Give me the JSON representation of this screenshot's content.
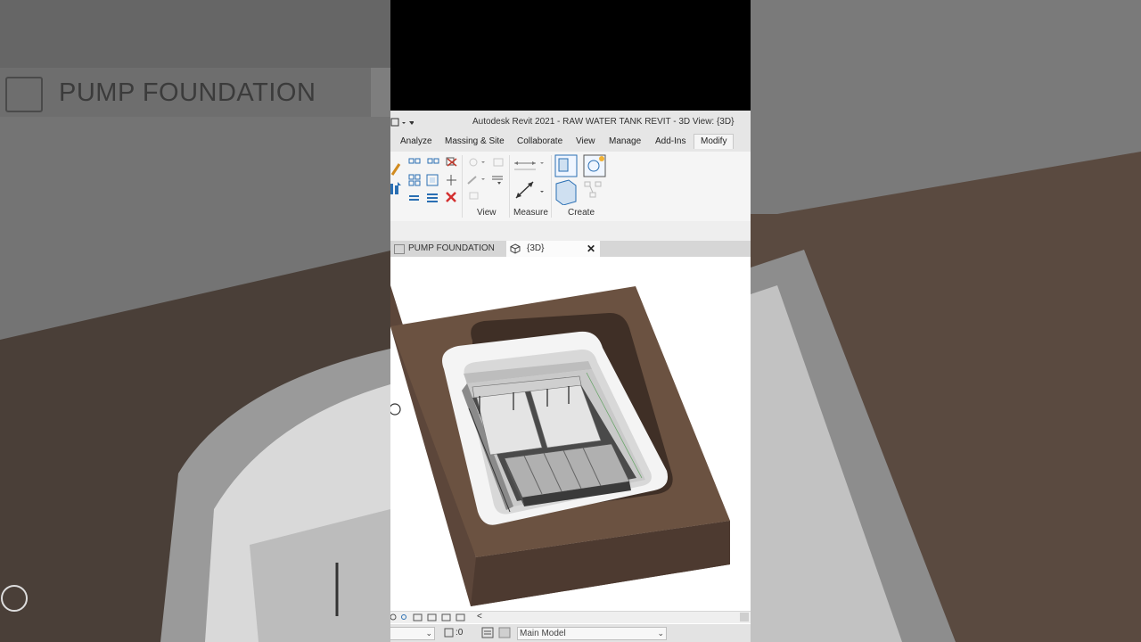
{
  "background": {
    "tab_label": "PUMP FOUNDATION"
  },
  "titlebar": {
    "title": "Autodesk Revit 2021 - RAW WATER TANK REVIT - 3D View: {3D}"
  },
  "ribbon": {
    "tabs": [
      "Analyze",
      "Massing & Site",
      "Collaborate",
      "View",
      "Manage",
      "Add-Ins",
      "Modify"
    ],
    "active_tab": "Modify",
    "groups": {
      "view": "View",
      "measure": "Measure",
      "create": "Create"
    }
  },
  "document_tabs": [
    {
      "label": "PUMP FOUNDATION",
      "icon": "floor-plan-icon"
    },
    {
      "label": "{3D}",
      "icon": "3d-view-icon",
      "active": true
    }
  ],
  "statusbar": {
    "scroll_left": "<",
    "count": ":0",
    "workset": "Main Model"
  },
  "colors": {
    "foundation": "#6b5241",
    "ribbon_bg": "#f5f5f5",
    "titlebar_bg": "#e6e6e6",
    "active_tab_bg": "#fbfbfb"
  }
}
